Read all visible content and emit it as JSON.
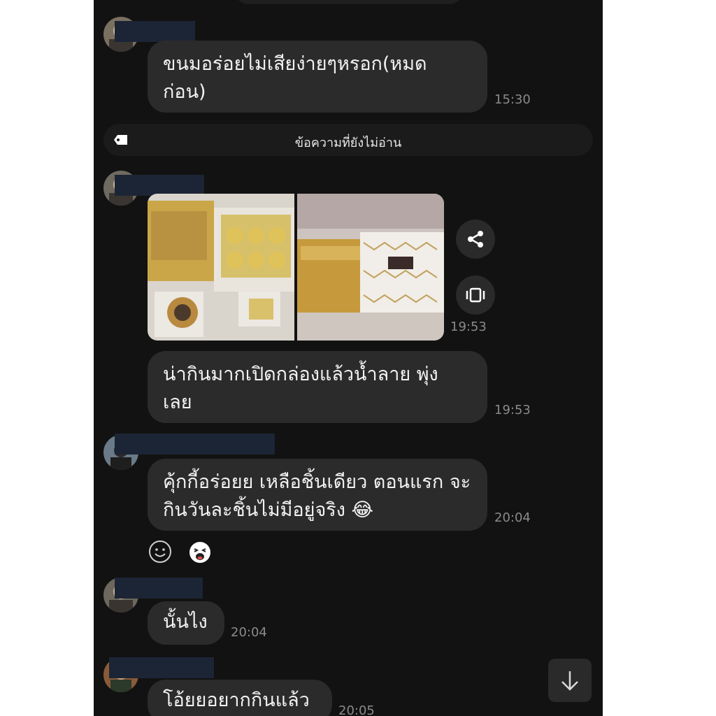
{
  "messages": [
    {
      "text": "ขนมอร่อยไม่เสียง่ายๆหรอก(หมด ก่อน)",
      "time": "15:30"
    },
    {
      "time": "19:53"
    },
    {
      "text": "น่ากินมากเปิดกล่องแล้วน้ำลาย พุ่ง เลย",
      "time": "19:53"
    },
    {
      "text": "คุ้กกี้อร่อยย เหลือชิ้นเดียว ตอนแรก จะกินวันละชิ้นไม่มีอยู่จริง 😂",
      "time": "20:04"
    },
    {
      "text": "นั้นไง",
      "time": "20:04"
    },
    {
      "text": "โอ้ยยอยากกินแล้ว",
      "time": "20:05"
    }
  ],
  "unread_divider": {
    "label": "ข้อความที่ยังไม่อ่าน",
    "icon": "tag-icon"
  },
  "reactions": {
    "add_icon": "smiley-outline-icon",
    "sticker_icon": "laughing-face-icon"
  },
  "photo_actions": {
    "share_icon": "share-icon",
    "album_icon": "album-icon"
  },
  "scroll": {
    "icon": "arrow-down-icon"
  },
  "colors": {
    "background": "#121212",
    "bubble": "#2b2b2b",
    "text": "#f2f2f2",
    "time": "#8a8a8a"
  }
}
